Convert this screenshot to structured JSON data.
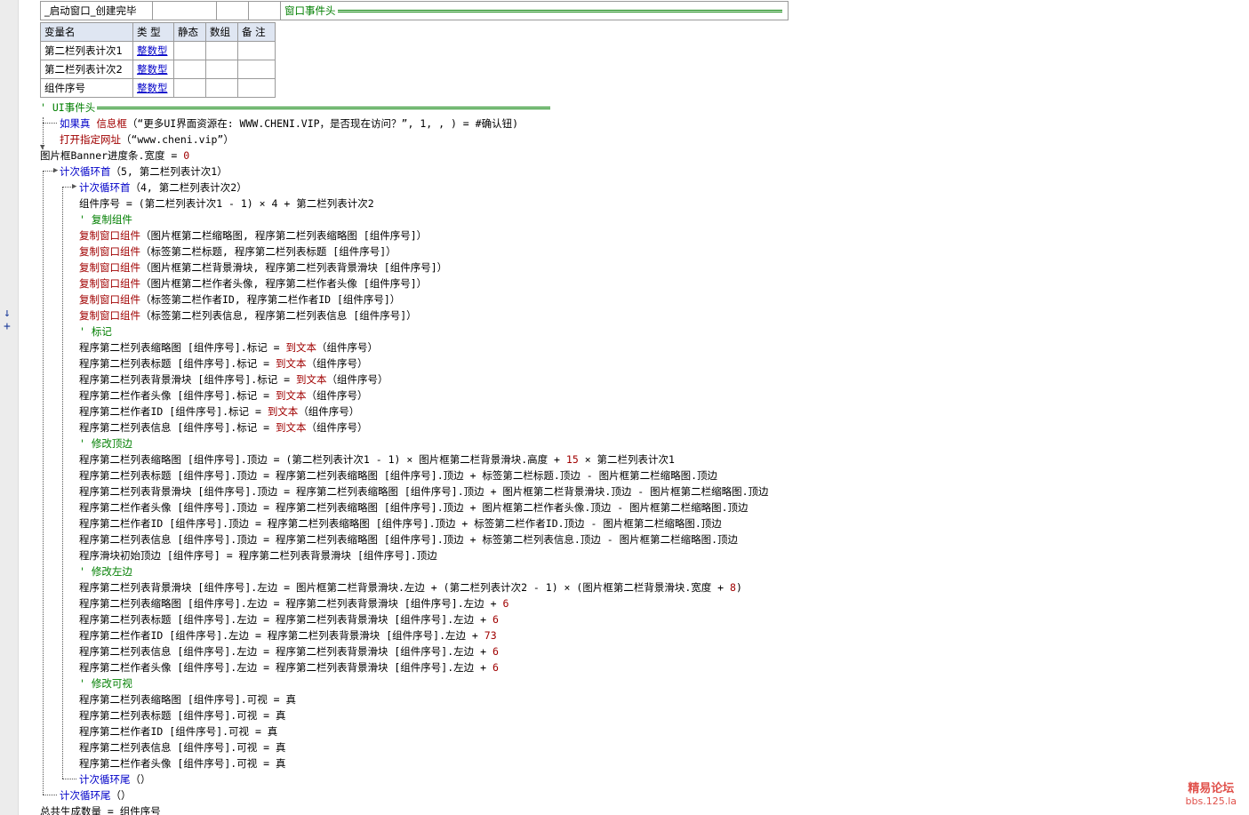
{
  "sub_header": {
    "name": "_启动窗口_创建完毕",
    "event_label": "窗口事件头"
  },
  "var_table": {
    "headers": [
      "变量名",
      "类 型",
      "静态",
      "数组",
      "备 注"
    ],
    "rows": [
      {
        "name": "第二栏列表计次1",
        "type": "整数型"
      },
      {
        "name": "第二栏列表计次2",
        "type": "整数型"
      },
      {
        "name": "组件序号",
        "type": "整数型"
      }
    ]
  },
  "code": {
    "l01_comment": "' UI事件头",
    "l02_kw": "如果真",
    "l02_fn": "信息框",
    "l02_rest": "（“更多UI界面资源在: WWW.CHENI.VIP，是否现在访问？”, 1, , ) = #确认钮)",
    "l03_fn": "打开指定网址",
    "l03_rest": "（“www.cheni.vip”）",
    "l04": "图片框Banner进度条.宽度 = ",
    "l04_num": "0",
    "l05_kw": "计次循环首",
    "l05_rest": "（5, 第二栏列表计次1）",
    "l06_kw": "计次循环首",
    "l06_rest": "（4, 第二栏列表计次2）",
    "l07": "组件序号 = (第二栏列表计次1 - 1) × 4 + 第二栏列表计次2",
    "l08_comment": "' 复制组件",
    "l09_fn": "复制窗口组件",
    "l09_rest": "（图片框第二栏缩略图, 程序第二栏列表缩略图 [组件序号]）",
    "l10_fn": "复制窗口组件",
    "l10_rest": "（标签第二栏标题, 程序第二栏列表标题 [组件序号]）",
    "l11_fn": "复制窗口组件",
    "l11_rest": "（图片框第二栏背景滑块, 程序第二栏列表背景滑块 [组件序号]）",
    "l12_fn": "复制窗口组件",
    "l12_rest": "（图片框第二栏作者头像, 程序第二栏作者头像 [组件序号]）",
    "l13_fn": "复制窗口组件",
    "l13_rest": "（标签第二栏作者ID, 程序第二栏作者ID [组件序号]）",
    "l14_fn": "复制窗口组件",
    "l14_rest": "（标签第二栏列表信息, 程序第二栏列表信息 [组件序号]）",
    "l15_comment": "' 标记",
    "l16_a": "程序第二栏列表缩略图 [组件序号].标记 = ",
    "l17_a": "程序第二栏列表标题 [组件序号].标记 = ",
    "l18_a": "程序第二栏列表背景滑块 [组件序号].标记 = ",
    "l19_a": "程序第二栏作者头像 [组件序号].标记 = ",
    "l20_a": "程序第二栏作者ID [组件序号].标记 = ",
    "l21_a": "程序第二栏列表信息 [组件序号].标记 = ",
    "to_text_fn": "到文本",
    "to_text_arg": "（组件序号）",
    "l22_comment": "' 修改顶边",
    "l23_a": "程序第二栏列表缩略图 [组件序号].顶边 = (第二栏列表计次1 - 1) × 图片框第二栏背景滑块.高度 + ",
    "l23_num": "15",
    "l23_b": " × 第二栏列表计次1",
    "l24": "程序第二栏列表标题 [组件序号].顶边 = 程序第二栏列表缩略图 [组件序号].顶边 + 标签第二栏标题.顶边 - 图片框第二栏缩略图.顶边",
    "l25": "程序第二栏列表背景滑块 [组件序号].顶边 = 程序第二栏列表缩略图 [组件序号].顶边 + 图片框第二栏背景滑块.顶边 - 图片框第二栏缩略图.顶边",
    "l26": "程序第二栏作者头像 [组件序号].顶边 = 程序第二栏列表缩略图 [组件序号].顶边 + 图片框第二栏作者头像.顶边 - 图片框第二栏缩略图.顶边",
    "l27": "程序第二栏作者ID [组件序号].顶边 = 程序第二栏列表缩略图 [组件序号].顶边 + 标签第二栏作者ID.顶边 - 图片框第二栏缩略图.顶边",
    "l28": "程序第二栏列表信息 [组件序号].顶边 = 程序第二栏列表缩略图 [组件序号].顶边 + 标签第二栏列表信息.顶边 - 图片框第二栏缩略图.顶边",
    "l29": "程序滑块初始顶边 [组件序号] = 程序第二栏列表背景滑块 [组件序号].顶边",
    "l30_comment": "' 修改左边",
    "l31_a": "程序第二栏列表背景滑块 [组件序号].左边 = 图片框第二栏背景滑块.左边 + (第二栏列表计次2 - 1) × (图片框第二栏背景滑块.宽度 + ",
    "l31_num": "8",
    "l31_b": ")",
    "l32_a": "程序第二栏列表缩略图 [组件序号].左边 = 程序第二栏列表背景滑块 [组件序号].左边 + ",
    "l32_num": "6",
    "l33_a": "程序第二栏列表标题 [组件序号].左边 = 程序第二栏列表背景滑块 [组件序号].左边 + ",
    "l33_num": "6",
    "l34_a": "程序第二栏作者ID [组件序号].左边 = 程序第二栏列表背景滑块 [组件序号].左边 + ",
    "l34_num": "73",
    "l35_a": "程序第二栏列表信息 [组件序号].左边 = 程序第二栏列表背景滑块 [组件序号].左边 + ",
    "l35_num": "6",
    "l36_a": "程序第二栏作者头像 [组件序号].左边 = 程序第二栏列表背景滑块 [组件序号].左边 + ",
    "l36_num": "6",
    "l37_comment": "' 修改可视",
    "l38": "程序第二栏列表缩略图 [组件序号].可视 = 真",
    "l39": "程序第二栏列表标题 [组件序号].可视 = 真",
    "l40": "程序第二栏作者ID [组件序号].可视 = 真",
    "l41": "程序第二栏列表信息 [组件序号].可视 = 真",
    "l42": "程序第二栏作者头像 [组件序号].可视 = 真",
    "l43_kw": "计次循环尾",
    "l43_rest": "（）",
    "l44_kw": "计次循环尾",
    "l44_rest": "（）",
    "l45": "总共生成数量 = 组件序号"
  },
  "gutter_marks": "↓ +",
  "watermark": {
    "line1": "精易论坛",
    "line2": "bbs.125.la"
  }
}
